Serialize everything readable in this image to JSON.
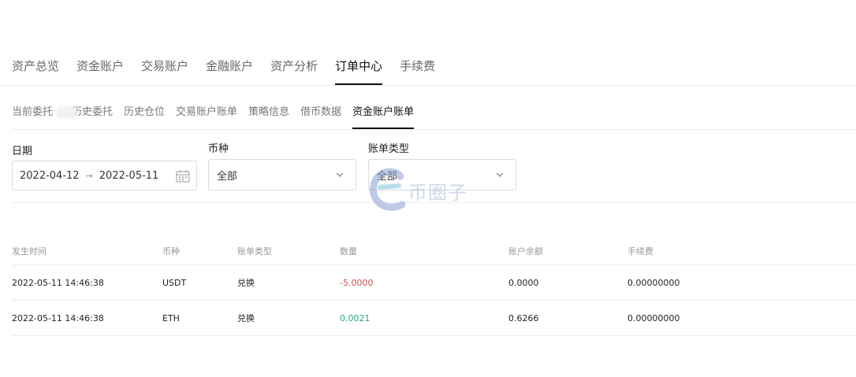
{
  "top_tabs": {
    "items": [
      "资产总览",
      "资金账户",
      "交易账户",
      "金融账户",
      "资产分析",
      "订单中心",
      "手续费"
    ],
    "active_index": 5
  },
  "sub_tabs": {
    "items": [
      "当前委托",
      "历史委托",
      "历史仓位",
      "交易账户账单",
      "策略信息",
      "借币数据",
      "资金账户账单"
    ],
    "active_index": 6
  },
  "filters": {
    "date": {
      "label": "日期",
      "start": "2022-04-12",
      "arrow": "→",
      "end": "2022-05-11",
      "icon": "calendar-icon"
    },
    "currency": {
      "label": "币种",
      "value": "全部",
      "icon": "chevron-down-icon"
    },
    "bill_type": {
      "label": "账单类型",
      "value": "全部",
      "icon": "chevron-down-icon"
    }
  },
  "table": {
    "headers": [
      "发生时间",
      "币种",
      "账单类型",
      "数量",
      "账户余额",
      "手续费"
    ],
    "rows": [
      {
        "time": "2022-05-11 14:46:38",
        "currency": "USDT",
        "type": "兑换",
        "amount": "-5.0000",
        "balance": "0.0000",
        "fee": "0.00000000"
      },
      {
        "time": "2022-05-11 14:46:38",
        "currency": "ETH",
        "type": "兑换",
        "amount": "0.0021",
        "balance": "0.6266",
        "fee": "0.00000000"
      }
    ]
  },
  "watermark": {
    "text": "币圈子"
  },
  "colors": {
    "negative": "#d0504f",
    "positive": "#2aa87a",
    "active_text": "#111111"
  }
}
